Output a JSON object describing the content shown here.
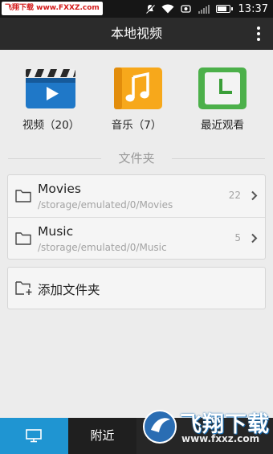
{
  "status_bar": {
    "watermark_text": "飞翔下载 www.FXXZ.com",
    "time": "13:37",
    "battery_level_percent": 90,
    "icons": [
      "notification-off-icon",
      "wifi-icon",
      "battery-saver-icon",
      "signal-icon",
      "battery-icon"
    ]
  },
  "app_bar": {
    "title": "本地视频",
    "overflow_icon": "more-vertical-icon"
  },
  "shortcuts": [
    {
      "label": "视频（20）",
      "icon": "video-clapperboard-icon"
    },
    {
      "label": "音乐（7）",
      "icon": "music-note-icon"
    },
    {
      "label": "最近观看",
      "icon": "clock-icon"
    }
  ],
  "folders_section": {
    "title": "文件夹",
    "folders": [
      {
        "name": "Movies",
        "path": "/storage/emulated/0/Movies",
        "count": "22"
      },
      {
        "name": "Music",
        "path": "/storage/emulated/0/Music",
        "count": "5"
      }
    ],
    "add_folder_label": "添加文件夹"
  },
  "bottom_nav": {
    "tabs": [
      {
        "name": "local",
        "icon": "monitor-icon",
        "active": true
      },
      {
        "name": "nearby",
        "label": "附近",
        "active": false
      }
    ]
  },
  "watermark": {
    "brand": "飞翔下载",
    "url": "www.fxxz.com"
  },
  "colors": {
    "accent": "#1f95d2",
    "app_bar": "#2b2b2b",
    "status_bar": "#161616",
    "background": "#ececec"
  }
}
